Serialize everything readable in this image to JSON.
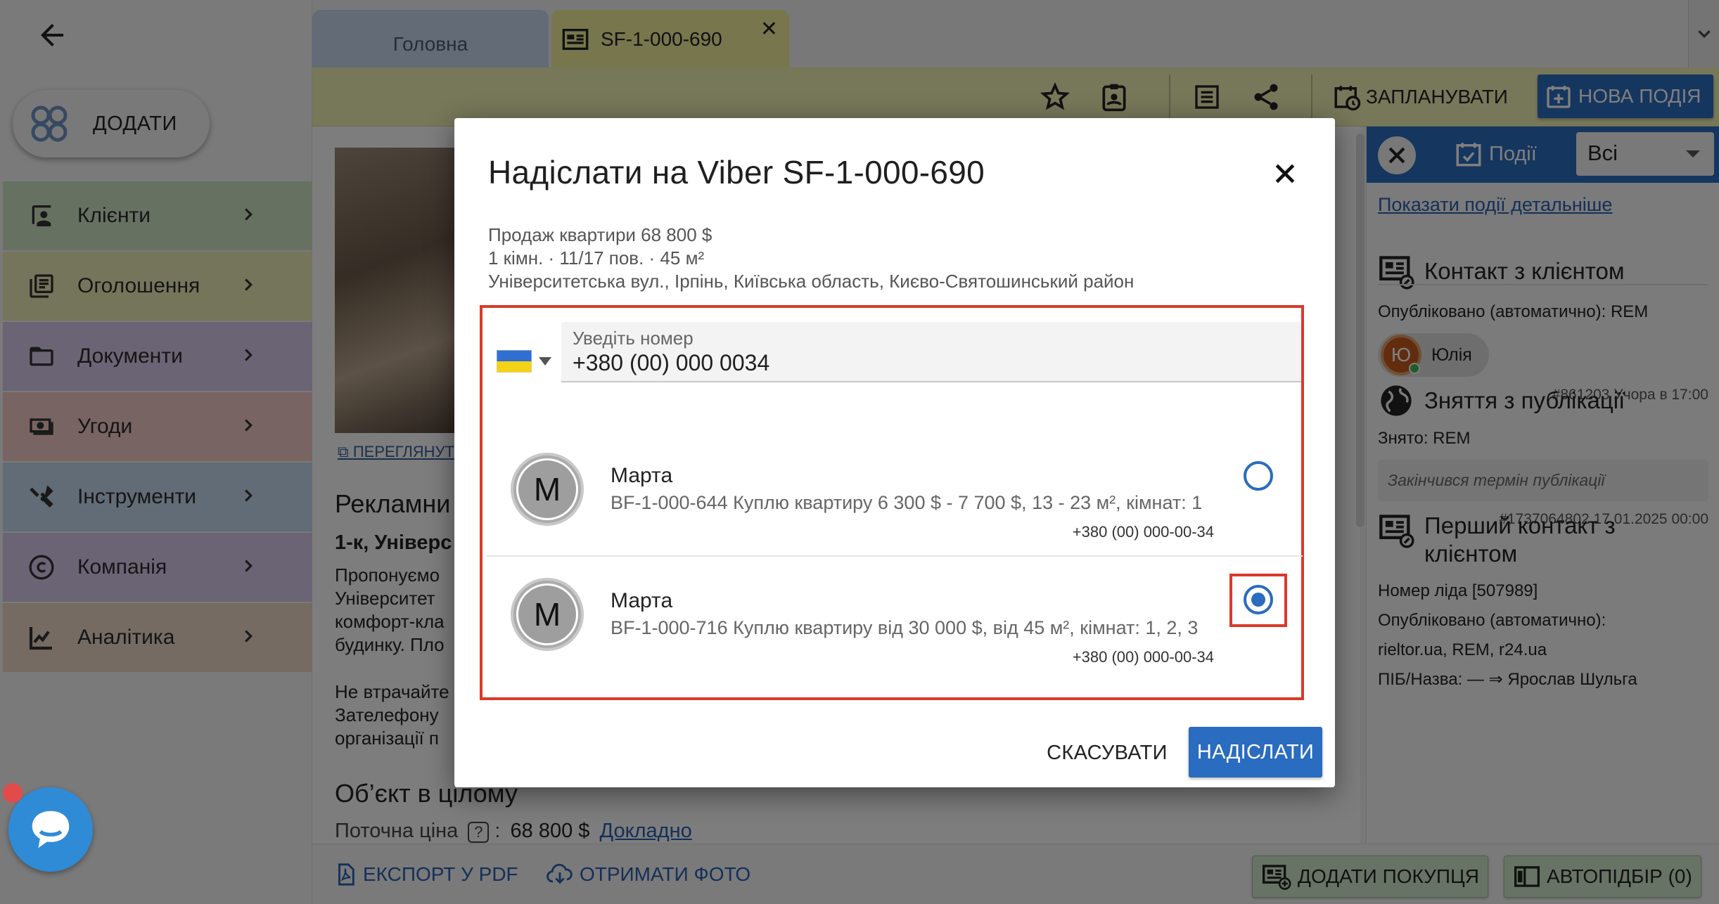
{
  "colors": {
    "primary": "#2a6cbf",
    "highlight": "#d93a2b",
    "tab_active": "#eeec9a",
    "tab_inactive": "#c4d7ec",
    "nav_clients": "#cfe3c5",
    "nav_listings": "#ebeab8",
    "nav_documents": "#d7c8e8",
    "nav_deals": "#f0c8c4",
    "nav_tools": "#c3d8ec",
    "nav_company": "#d7c8e8",
    "nav_analytics": "#ead6c4"
  },
  "sidebar": {
    "add_label": "ДОДАТИ",
    "items": [
      {
        "label": "Клієнти",
        "icon": "contacts-icon"
      },
      {
        "label": "Оголошення",
        "icon": "listings-icon"
      },
      {
        "label": "Документи",
        "icon": "folder-icon"
      },
      {
        "label": "Угоди",
        "icon": "deal-icon"
      },
      {
        "label": "Інструменти",
        "icon": "tools-icon"
      },
      {
        "label": "Компанія",
        "icon": "copyright-icon"
      },
      {
        "label": "Аналітика",
        "icon": "analytics-icon"
      }
    ]
  },
  "tabs": {
    "home": "Головна",
    "object": "SF-1-000-690"
  },
  "toolbar": {
    "schedule_label": "ЗАПЛАНУВАТИ",
    "new_event_label": "НОВА ПОДІЯ"
  },
  "content": {
    "view_link": "ПЕРЕГЛЯНУТ",
    "ad_title": "Рекламни",
    "ad_bold": "1-к, Універс",
    "desc_1": "Пропонуємо\nУніверситет\nкомфорт-кла\nбудинку. Пло",
    "desc_2": "Не втрачайте\nЗателефону\nорганізації п",
    "object_title": "Об’єкт в цілому",
    "price_label": "Поточна ціна",
    "price_help": "?",
    "price_colon": ":",
    "price_value": "68 800 $",
    "price_more": "Докладно"
  },
  "bottom_bar": {
    "export_pdf": "ЕКСПОРТ У PDF",
    "get_photo": "ОТРИМАТИ ФОТО",
    "add_buyer": "ДОДАТИ ПОКУПЦЯ",
    "autoselect": "АВТОПІДБІР (0)"
  },
  "events": {
    "title": "Події",
    "filter_value": "Всі",
    "detail_link": "Показати події детальніше",
    "cards": [
      {
        "title": "Контакт з клієнтом",
        "text": "Опубліковано (автоматично): REM",
        "chip_initial": "Ю",
        "chip_name": "Юлія",
        "meta": "#861203    Учора в 17:00"
      },
      {
        "title": "Зняття з публікації",
        "text": "Знято: REM",
        "note": "Закінчився термін публікації",
        "meta": "#1737064802    17.01.2025 00:00"
      },
      {
        "title_1": "Перший контакт з",
        "title_2": "клієнтом",
        "line_1": "Номер ліда [507989]",
        "line_2": "Опубліковано (автоматично):",
        "line_3": "rieltor.ua, REM, r24.ua",
        "line_4": "ПІБ/Назва: — ⇒ Ярослав Шульга"
      }
    ]
  },
  "modal": {
    "title": "Надіслати на Viber SF-1-000-690",
    "sub_1": "Продаж квартири 68 800 $",
    "sub_2": "1 кімн. · 11/17 пов. · 45 м²",
    "sub_3": "Університетська вул., Ірпінь, Київська область, Києво-Святошинський район",
    "phone_label": "Уведіть номер",
    "phone_value": "+380 (00) 000 0034",
    "contacts": [
      {
        "initial": "М",
        "name": "Марта",
        "desc": "BF-1-000-644 Куплю квартиру 6 300 $ - 7 700 $, 13 - 23 м², кімнат: 1",
        "phone": "+380 (00) 000-00-34",
        "selected": false
      },
      {
        "initial": "М",
        "name": "Марта",
        "desc": "BF-1-000-716 Куплю квартиру від 30 000 $, від 45 м², кімнат: 1, 2, 3",
        "phone": "+380 (00) 000-00-34",
        "selected": true
      }
    ],
    "cancel_label": "СКАСУВАТИ",
    "send_label": "НАДІСЛАТИ"
  }
}
